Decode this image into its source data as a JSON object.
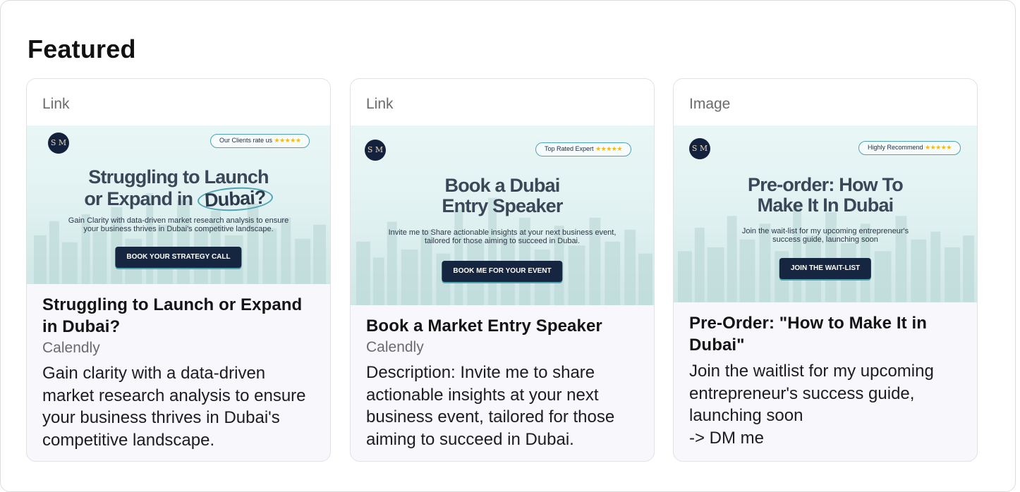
{
  "section": {
    "title": "Featured"
  },
  "cards": [
    {
      "type": "Link",
      "banner": {
        "badge_text": "Our Clients rate us",
        "badge_stars": "★★★★★",
        "logo_text": "S M",
        "headline_line1": "Struggling to Launch",
        "headline_line2_pre": "or Expand in",
        "headline_line2_hl": "Dubai?",
        "subtext": "Gain Clarity with data-driven market research analysis to ensure your business thrives in Dubai's competitive landscape.",
        "cta": "BOOK YOUR STRATEGY CALL"
      },
      "title": "Struggling to Launch or Expand in Dubai?",
      "source": "Calendly",
      "description": "Gain clarity with a data-driven market research analysis to ensure your business thrives in Dubai's competitive landscape."
    },
    {
      "type": "Link",
      "banner": {
        "badge_text": "Top Rated Expert",
        "badge_stars": "★★★★★",
        "logo_text": "S M",
        "headline_line1": "Book a Dubai",
        "headline_line2": "Entry Speaker",
        "subtext": "Invite me to Share actionable insights at your next business event, tailored for those aiming to succeed in Dubai.",
        "cta": "BOOK ME FOR YOUR EVENT"
      },
      "title": "Book a Market Entry Speaker",
      "source": "Calendly",
      "description": "Description: Invite me to share actionable insights at your next business event, tailored for those aiming to succeed in Dubai."
    },
    {
      "type": "Image",
      "banner": {
        "badge_text": "Highly Recommend",
        "badge_stars": "★★★★★",
        "logo_text": "S M",
        "headline_line1": "Pre-order: How To",
        "headline_line2": "Make It In Dubai",
        "subtext": "Join the wait-list for my upcoming entrepreneur's success guide, launching soon",
        "cta": "JOIN THE WAIT-LIST"
      },
      "title": "Pre-Order: \"How to Make It in Dubai\"",
      "source": "",
      "description": "Join the waitlist for my upcoming entrepreneur's success guide, launching soon\n-> DM me"
    }
  ]
}
